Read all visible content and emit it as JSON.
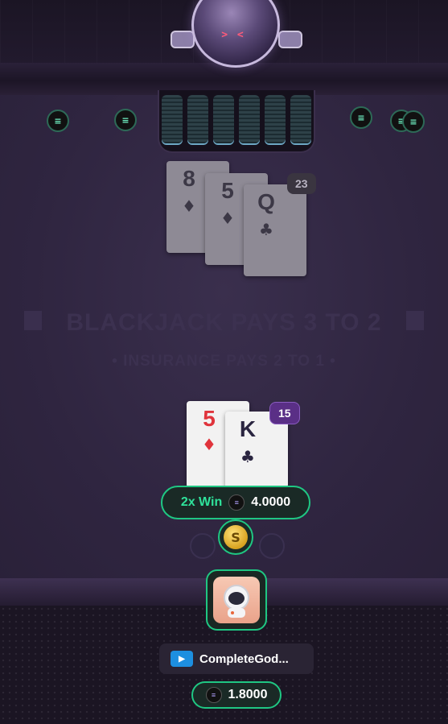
{
  "dealer": {
    "eyes_text": "> <",
    "hand": {
      "cards": [
        {
          "rank": "8",
          "suit": "♦"
        },
        {
          "rank": "5",
          "suit": "♦"
        },
        {
          "rank": "Q",
          "suit": "♣"
        }
      ],
      "total": "23"
    }
  },
  "table": {
    "rule_main": "BLACKJACK PAYS 3 TO 2",
    "rule_sub": "• INSURANCE PAYS 2 TO 1 •"
  },
  "player": {
    "hand": {
      "cards": [
        {
          "rank": "5",
          "suit": "♦"
        },
        {
          "rank": "K",
          "suit": "♣"
        }
      ],
      "total": "15"
    },
    "result": {
      "label": "2x Win",
      "amount": "4.0000",
      "coin_icon": "sol-coin-icon"
    },
    "name": "CompleteGod...",
    "balance": "1.8000"
  },
  "colors": {
    "accent_green": "#1fc783",
    "player_total_badge": "#5a2f86",
    "dealer_total_badge": "#3a3540"
  }
}
